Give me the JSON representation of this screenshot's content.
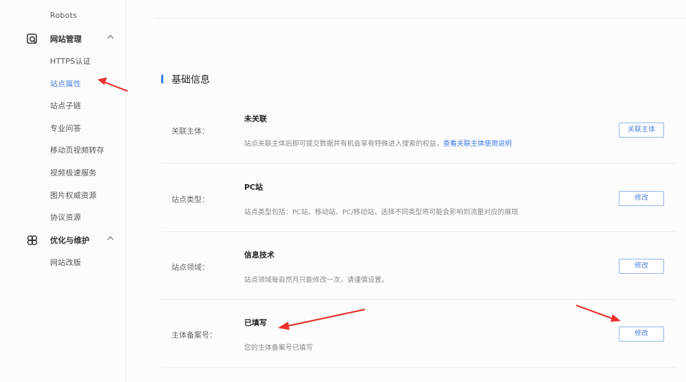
{
  "sidebar": {
    "top_item": "Robots",
    "groups": [
      {
        "label": "网站管理",
        "icon": "site-manage-icon",
        "expanded": true,
        "items": [
          {
            "label": "HTTPS认证",
            "active": false
          },
          {
            "label": "站点属性",
            "active": true
          },
          {
            "label": "站点子链",
            "active": false
          },
          {
            "label": "专业问答",
            "active": false
          },
          {
            "label": "移动页视频转存",
            "active": false
          },
          {
            "label": "视频极速服务",
            "active": false
          },
          {
            "label": "图片权威资源",
            "active": false
          },
          {
            "label": "协议资源",
            "active": false
          }
        ]
      },
      {
        "label": "优化与维护",
        "icon": "optimize-icon",
        "expanded": true,
        "items": [
          {
            "label": "网站改版",
            "active": false
          }
        ]
      }
    ]
  },
  "main": {
    "section_title": "基础信息",
    "accent_color": "#3b7be8",
    "rows": [
      {
        "label": "关联主体：",
        "value": "未关联",
        "desc": "站点关联主体后即可提交数据并有机会享有特殊进入搜索的权益，",
        "desc_link": "查看关联主体使用说明",
        "button": "关联主体"
      },
      {
        "label": "站点类型：",
        "value": "PC站",
        "desc": "站点类型包括：PC站、移动站、PC/移动站，选择不同类型将可能会影响到流量对应的展现",
        "desc_link": "",
        "button": "修改"
      },
      {
        "label": "站点领域：",
        "value": "信息技术",
        "desc": "站点领域每自然月只能修改一次，请谨慎设置。",
        "desc_link": "",
        "button": "修改"
      },
      {
        "label": "主体备案号：",
        "value": "已填写",
        "desc": "您的主体备案号已填写",
        "desc_link": "",
        "button": "修改"
      }
    ]
  },
  "annotations": {
    "arrow_color": "#e8322b"
  }
}
